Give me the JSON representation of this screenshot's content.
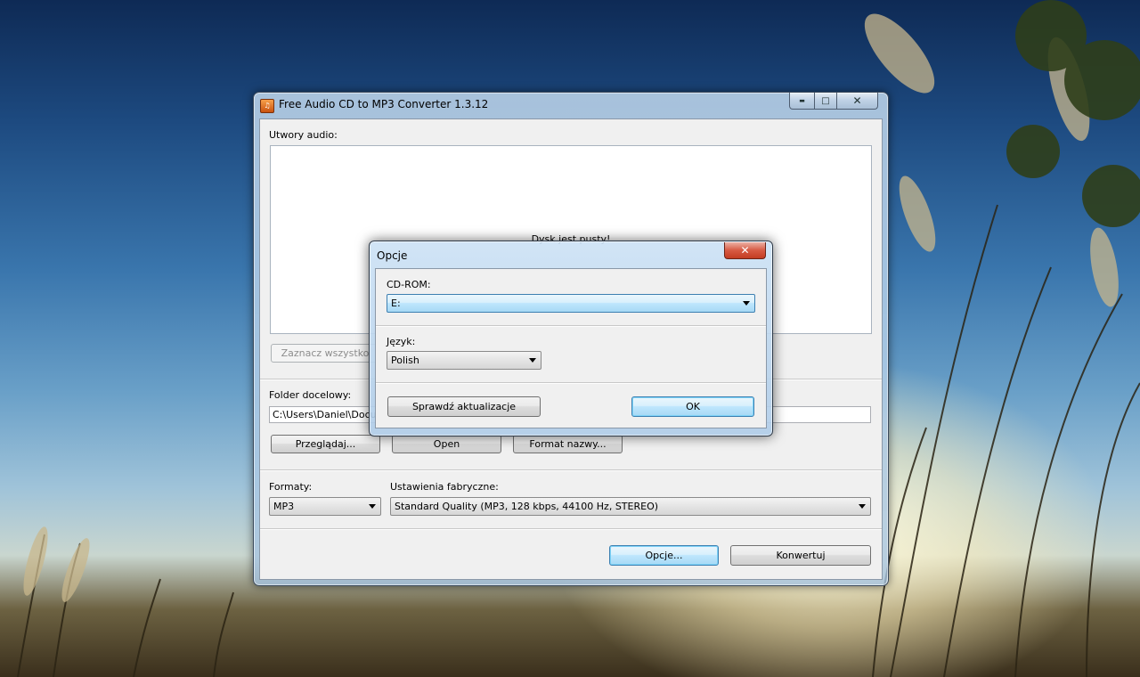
{
  "main_window": {
    "title": "Free Audio CD to MP3 Converter 1.3.12",
    "title_icon_glyph": "♫",
    "min_glyph": "▬",
    "max_glyph": "□",
    "close_glyph": "✕",
    "tracks_label": "Utwory audio:",
    "empty_message": "Dysk jest pusty!",
    "select_all_label": "Zaznacz wszystko",
    "folder_label": "Folder docelowy:",
    "folder_path": "C:\\Users\\Daniel\\Documents\\Free Audio CD to MP3 Converter",
    "browse_label": "Przeglądaj...",
    "open_label": "Open",
    "name_format_label": "Format nazwy...",
    "formats_label": "Formaty:",
    "format_value": "MP3",
    "presets_label": "Ustawienia fabryczne:",
    "preset_value": "Standard Quality (MP3, 128 kbps, 44100 Hz, STEREO)",
    "options_label": "Opcje...",
    "convert_label": "Konwertuj"
  },
  "options_dialog": {
    "title": "Opcje",
    "close_glyph": "✕",
    "cdrom_label": "CD-ROM:",
    "cdrom_value": "E:",
    "language_label": "Język:",
    "language_value": "Polish",
    "check_updates_label": "Sprawdź aktualizacje",
    "ok_label": "OK"
  },
  "colors": {
    "default_button_border": "#3c7fb1",
    "close_button": "#c33c22"
  }
}
